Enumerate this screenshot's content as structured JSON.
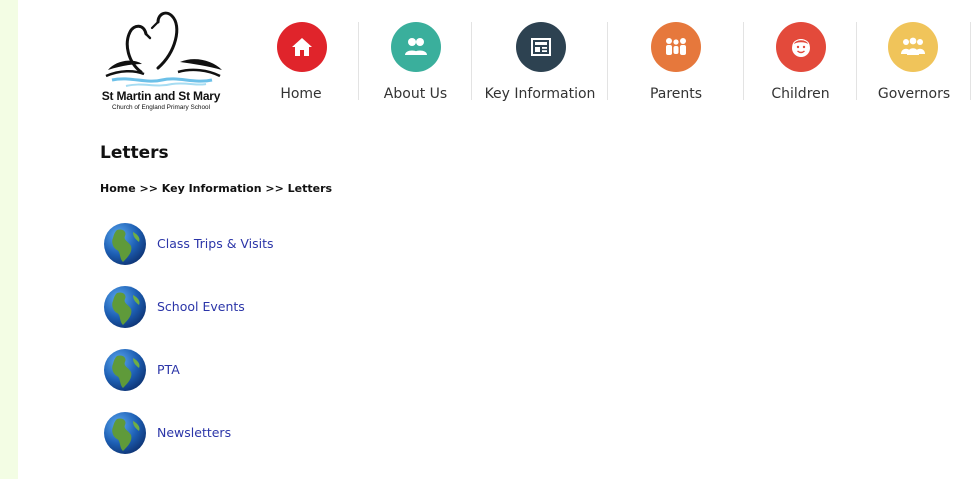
{
  "school": {
    "name": "St Martin and St Mary",
    "subtitle": "Church of England Primary School"
  },
  "nav": [
    {
      "label": "Home",
      "icon": "home-icon",
      "color": "#e0242b"
    },
    {
      "label": "About Us",
      "icon": "people-icon",
      "color": "#3aaf9c"
    },
    {
      "label": "Key Information",
      "icon": "newspaper-icon",
      "color": "#2d4251"
    },
    {
      "label": "Parents",
      "icon": "family-icon",
      "color": "#e6783c"
    },
    {
      "label": "Children",
      "icon": "child-face-icon",
      "color": "#e34a3b"
    },
    {
      "label": "Governors",
      "icon": "group-icon",
      "color": "#f0c45a"
    }
  ],
  "page": {
    "title": "Letters",
    "breadcrumb": {
      "home": "Home",
      "sep1": " >> ",
      "key_info": "Key Information",
      "sep2": " >> ",
      "current": "Letters"
    }
  },
  "letters": [
    {
      "label": "Class Trips & Visits",
      "icon": "globe-icon"
    },
    {
      "label": "School Events",
      "icon": "globe-icon"
    },
    {
      "label": "PTA",
      "icon": "globe-icon"
    },
    {
      "label": "Newsletters",
      "icon": "globe-icon"
    }
  ],
  "colors": {
    "background": "#f3fde4",
    "link": "#2b35a8"
  }
}
